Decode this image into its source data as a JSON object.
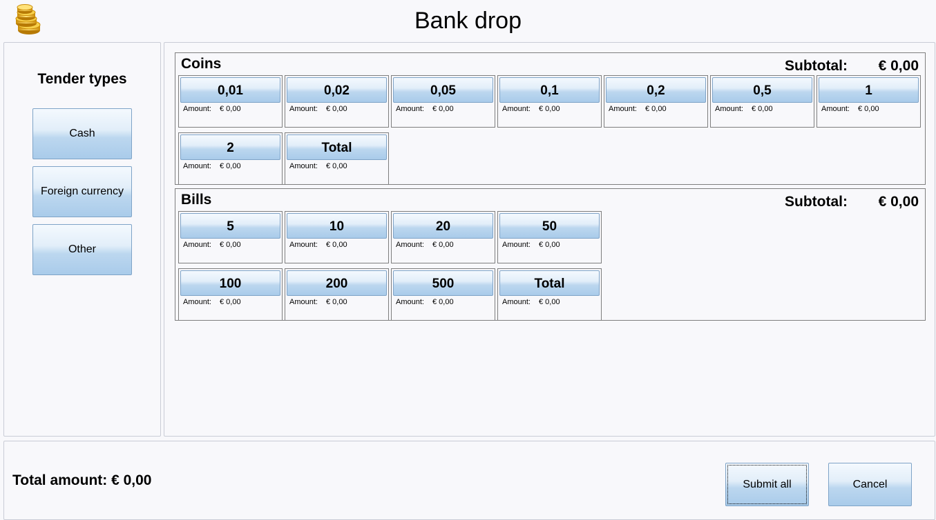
{
  "title": "Bank drop",
  "tender": {
    "title": "Tender types",
    "items": [
      {
        "label": "Cash"
      },
      {
        "label": "Foreign currency"
      },
      {
        "label": "Other"
      }
    ]
  },
  "coins": {
    "title": "Coins",
    "subtotal_label": "Subtotal:",
    "subtotal_value": "€ 0,00",
    "cells": [
      {
        "label": "0,01",
        "amount_label": "Amount:",
        "amount": "€ 0,00"
      },
      {
        "label": "0,02",
        "amount_label": "Amount:",
        "amount": "€ 0,00"
      },
      {
        "label": "0,05",
        "amount_label": "Amount:",
        "amount": "€ 0,00"
      },
      {
        "label": "0,1",
        "amount_label": "Amount:",
        "amount": "€ 0,00"
      },
      {
        "label": "0,2",
        "amount_label": "Amount:",
        "amount": "€ 0,00"
      },
      {
        "label": "0,5",
        "amount_label": "Amount:",
        "amount": "€ 0,00"
      },
      {
        "label": "1",
        "amount_label": "Amount:",
        "amount": "€ 0,00"
      },
      {
        "label": "2",
        "amount_label": "Amount:",
        "amount": "€ 0,00"
      },
      {
        "label": "Total",
        "amount_label": "Amount:",
        "amount": "€ 0,00"
      }
    ]
  },
  "bills": {
    "title": "Bills",
    "subtotal_label": "Subtotal:",
    "subtotal_value": "€ 0,00",
    "cells": [
      {
        "label": "5",
        "amount_label": "Amount:",
        "amount": "€ 0,00"
      },
      {
        "label": "10",
        "amount_label": "Amount:",
        "amount": "€ 0,00"
      },
      {
        "label": "20",
        "amount_label": "Amount:",
        "amount": "€ 0,00"
      },
      {
        "label": "50",
        "amount_label": "Amount:",
        "amount": "€ 0,00"
      },
      {
        "label": "100",
        "amount_label": "Amount:",
        "amount": "€ 0,00"
      },
      {
        "label": "200",
        "amount_label": "Amount:",
        "amount": "€ 0,00"
      },
      {
        "label": "500",
        "amount_label": "Amount:",
        "amount": "€ 0,00"
      },
      {
        "label": "Total",
        "amount_label": "Amount:",
        "amount": "€ 0,00"
      }
    ]
  },
  "footer": {
    "total_amount": "Total amount: € 0,00",
    "submit_label": "Submit all",
    "cancel_label": "Cancel"
  },
  "colors": {
    "background": "#f8f8fb",
    "button_top": "#f4f9fe",
    "button_bottom": "#a9cbea",
    "button_border": "#7ea3c7",
    "coin_gold": "#f2c21a"
  },
  "icons": {
    "logo": "coins-stack-icon"
  }
}
